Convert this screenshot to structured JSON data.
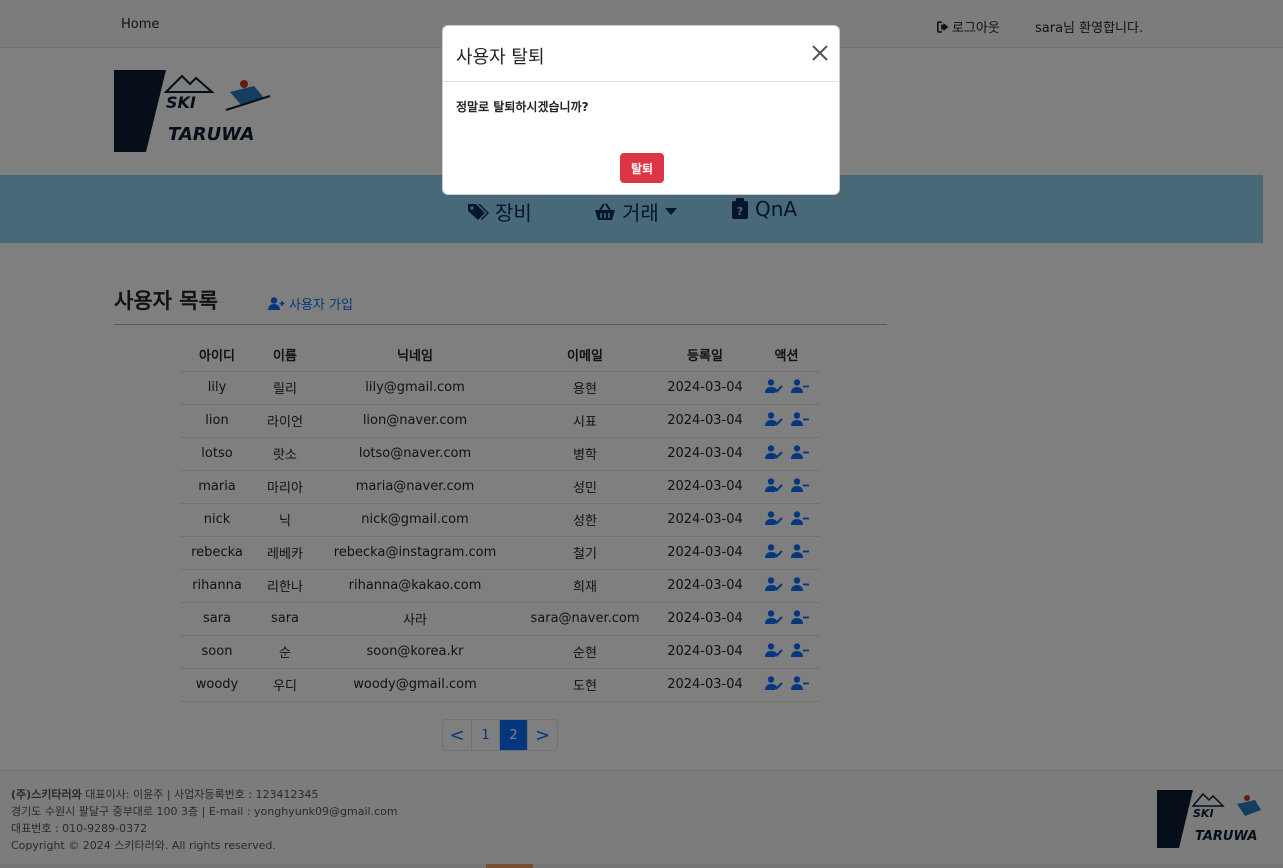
{
  "topbar": {
    "home": "Home",
    "logout": "로그아웃",
    "welcome": "sara님 환영합니다."
  },
  "logo": {
    "line1": "SKI",
    "line2": "TARUWA"
  },
  "menu": [
    {
      "label": "장비",
      "icon": "tags-icon"
    },
    {
      "label": "거래",
      "icon": "basket-icon"
    },
    {
      "label": "QnA",
      "icon": "clipboard-question-icon"
    }
  ],
  "section": {
    "title": "사용자 목록",
    "signup": "사용자 가입"
  },
  "table": {
    "headers": [
      "아이디",
      "이름",
      "닉네임",
      "이메일",
      "등록일",
      "액션"
    ],
    "rows": [
      [
        "lily",
        "릴리",
        "lily@gmail.com",
        "용현",
        "2024-03-04"
      ],
      [
        "lion",
        "라이언",
        "lion@naver.com",
        "시표",
        "2024-03-04"
      ],
      [
        "lotso",
        "랏소",
        "lotso@naver.com",
        "병학",
        "2024-03-04"
      ],
      [
        "maria",
        "마리아",
        "maria@naver.com",
        "성민",
        "2024-03-04"
      ],
      [
        "nick",
        "닉",
        "nick@gmail.com",
        "성한",
        "2024-03-04"
      ],
      [
        "rebecka",
        "레베카",
        "rebecka@instagram.com",
        "철기",
        "2024-03-04"
      ],
      [
        "rihanna",
        "리한나",
        "rihanna@kakao.com",
        "희재",
        "2024-03-04"
      ],
      [
        "sara",
        "sara",
        "사라",
        "sara@naver.com",
        "2024-03-04"
      ],
      [
        "soon",
        "순",
        "soon@korea.kr",
        "순현",
        "2024-03-04"
      ],
      [
        "woody",
        "우디",
        "woody@gmail.com",
        "도현",
        "2024-03-04"
      ]
    ]
  },
  "pagination": {
    "prev": "<",
    "pages": [
      "1",
      "2"
    ],
    "active": "2",
    "next": ">"
  },
  "footer": {
    "line1_company": "(주)스키타러와",
    "line1_rest": " 대표이사: 이윤주 | 사업자등록번호 : 123412345",
    "line2": "경기도 수원시 팔달구 중부대로 100 3층 | E-mail : yonghyunk09@gmail.com",
    "line3": "대표번호 : 010-9289-0372",
    "line4": "Copyright © 2024 스키타러와. All rights reserved."
  },
  "modal": {
    "title": "사용자 탈퇴",
    "body": "정말로 탈퇴하시겠습니까?",
    "confirm": "탈퇴"
  },
  "colors": {
    "menu_band": "#8fd3f0",
    "primary": "#0d6efd",
    "danger": "#dc3545"
  }
}
